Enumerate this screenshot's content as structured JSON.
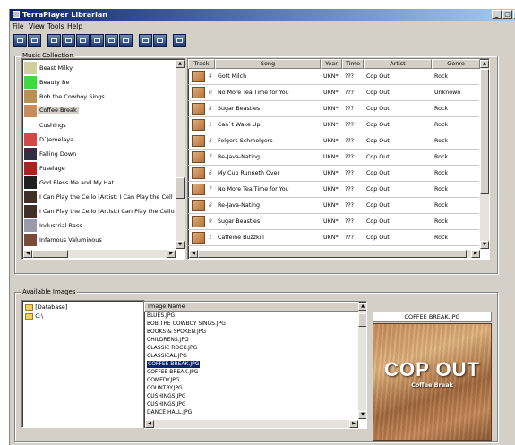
{
  "window": {
    "title": "TerraPlayer Librarian"
  },
  "caption_buttons": [
    "_",
    "□",
    "x"
  ],
  "menu": [
    "File",
    "View",
    "Tools",
    "Help"
  ],
  "music_collection": {
    "label": "Music Collection",
    "albums": [
      {
        "title": "Beast Milky",
        "thumb": "#cfcfa0"
      },
      {
        "title": "Beauty Be",
        "thumb": "#3ddc3d"
      },
      {
        "title": "Bob the Cowboy Sings",
        "thumb": "#b8905a"
      },
      {
        "title": "Coffee Break",
        "thumb": "#c98c5a",
        "selected": true
      },
      {
        "title": "Cushings",
        "thumb": "#ffffff"
      },
      {
        "title": "D`Jemelaya",
        "thumb": "#d04848"
      },
      {
        "title": "Falling Down",
        "thumb": "#303040"
      },
      {
        "title": "Fuselage",
        "thumb": "#b02020"
      },
      {
        "title": "God Bless Me and My Hat",
        "thumb": "#202020"
      },
      {
        "title": "I Can Play the Cello [Artist: I Can Play the Cell",
        "thumb": "#403028"
      },
      {
        "title": "I Can Play the Cello [Artist:I Can Play the Cello",
        "thumb": "#403028"
      },
      {
        "title": "Industrial Bass",
        "thumb": "#9a9aa8"
      },
      {
        "title": "Infamous Valuminous",
        "thumb": "#7a4a3a"
      }
    ]
  },
  "tracks": {
    "columns": [
      "Track",
      "Song",
      "Year",
      "Time",
      "Artist",
      "Genre"
    ],
    "rows": [
      {
        "num": "4",
        "song": "Gott Milch",
        "year": "UKN*",
        "time": "???",
        "artist": "Cop Out",
        "genre": "Rock"
      },
      {
        "num": "0",
        "song": "No More Tea Time for You",
        "year": "UKN*",
        "time": "???",
        "artist": "Cop Out",
        "genre": "Unknown"
      },
      {
        "num": "8",
        "song": "Sugar Beasties",
        "year": "UKN*",
        "time": "???",
        "artist": "Cop Out",
        "genre": "Rock"
      },
      {
        "num": "1",
        "song": "Can`t Wake Up",
        "year": "UKN*",
        "time": "???",
        "artist": "Cop Out",
        "genre": "Rock"
      },
      {
        "num": "3",
        "song": "Folgers Schmolgers",
        "year": "UKN*",
        "time": "???",
        "artist": "Cop Out",
        "genre": "Rock"
      },
      {
        "num": "7",
        "song": "Re-Java-Nating",
        "year": "UKN*",
        "time": "???",
        "artist": "Cop Out",
        "genre": "Rock"
      },
      {
        "num": "6",
        "song": "My Cup Runneth Over",
        "year": "UKN*",
        "time": "???",
        "artist": "Cop Out",
        "genre": "Rock"
      },
      {
        "num": "7",
        "song": "No More Tea Time for You",
        "year": "UKN*",
        "time": "???",
        "artist": "Cop Out",
        "genre": "Rock"
      },
      {
        "num": "8",
        "song": "Re-Java-Nating",
        "year": "UKN*",
        "time": "???",
        "artist": "Cop Out",
        "genre": "Rock"
      },
      {
        "num": "9",
        "song": "Sugar Beasties",
        "year": "UKN*",
        "time": "???",
        "artist": "Cop Out",
        "genre": "Rock"
      },
      {
        "num": "1",
        "song": "Caffeine Buzzkill",
        "year": "UKN*",
        "time": "???",
        "artist": "Cop Out",
        "genre": "Rock"
      }
    ]
  },
  "available_images": {
    "label": "Available Images",
    "folders": [
      "[Database]",
      "C:\\"
    ],
    "list_header": "Image Name",
    "images": [
      "BLUES.JPG",
      "BOB THE COWBOY SINGS.JPG",
      "BOOKS & SPOKEN.JPG",
      "CHILDRENS.JPG",
      "CLASSIC ROCK.JPG",
      "CLASSICAL.JPG",
      "COFFEE BREAK.JPG",
      "COFFEE BREAK.JPG",
      "COMEDY.JPG",
      "COUNTRY.JPG",
      "CUSHINGS.JPG",
      "CUSHINGS.JPG",
      "DANCE HALL.JPG"
    ],
    "selected_image": "COFFEE BREAK.JPG",
    "preview": {
      "caption": "COFFEE BREAK.JPG",
      "art_title": "COP OUT",
      "art_subtitle": "Coffee Break"
    }
  }
}
